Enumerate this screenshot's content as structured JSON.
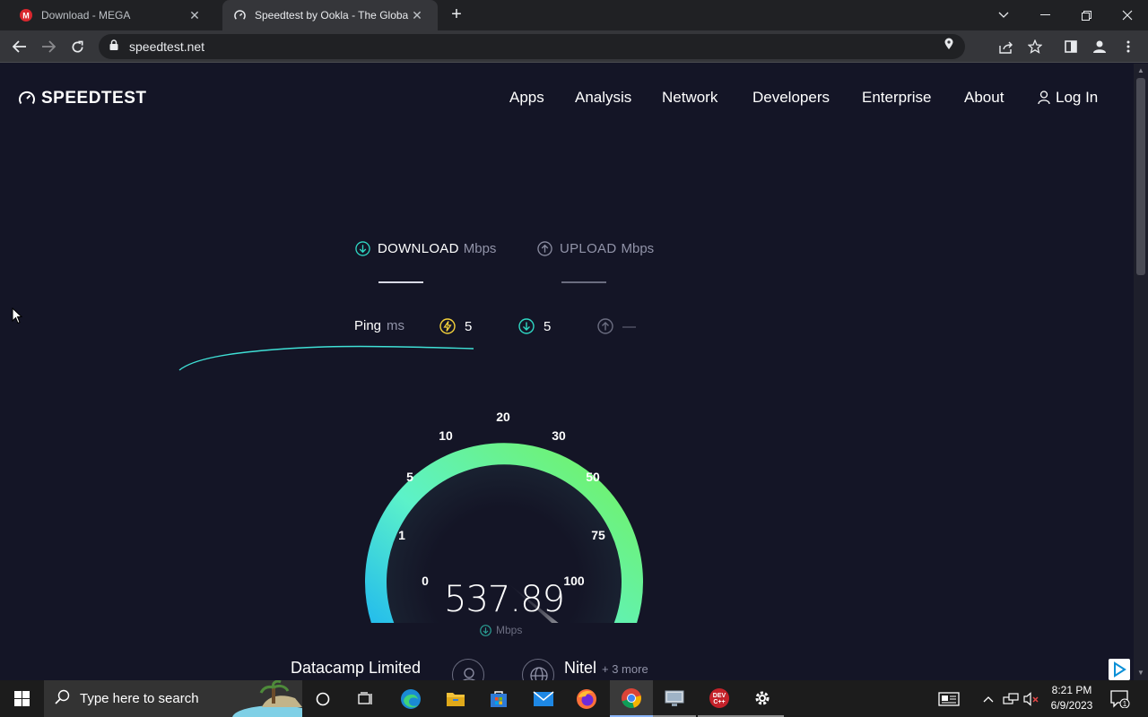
{
  "browser": {
    "tabs": [
      {
        "title": "Download - MEGA",
        "favicon": "mega-icon"
      },
      {
        "title": "Speedtest by Ookla - The Global",
        "favicon": "speedtest-icon"
      }
    ],
    "url": "speedtest.net"
  },
  "site": {
    "logo": "SPEEDTEST",
    "nav": [
      "Apps",
      "Analysis",
      "Network",
      "Developers",
      "Enterprise",
      "About"
    ],
    "login": "Log In"
  },
  "test": {
    "download_label": "DOWNLOAD",
    "upload_label": "UPLOAD",
    "unit": "Mbps",
    "ping_label": "Ping",
    "ping_unit": "ms",
    "ping_idle": "5",
    "ping_download": "5",
    "ping_upload": "—",
    "speed": "537.89",
    "speed_unit": "Mbps",
    "gauge_ticks": [
      "0",
      "1",
      "5",
      "10",
      "20",
      "30",
      "50",
      "75",
      "100"
    ]
  },
  "connection": {
    "isp": "Datacamp Limited",
    "server": "Nitel",
    "server_more": "+ 3 more"
  },
  "taskbar": {
    "search_placeholder": "Type here to search",
    "time": "8:21 PM",
    "date": "6/9/2023",
    "notifications": "1"
  },
  "colors": {
    "page_bg": "#141526",
    "gauge_start": "#1bb7f4",
    "gauge_mid": "#5cf0c8",
    "gauge_end": "#6cf26c"
  }
}
